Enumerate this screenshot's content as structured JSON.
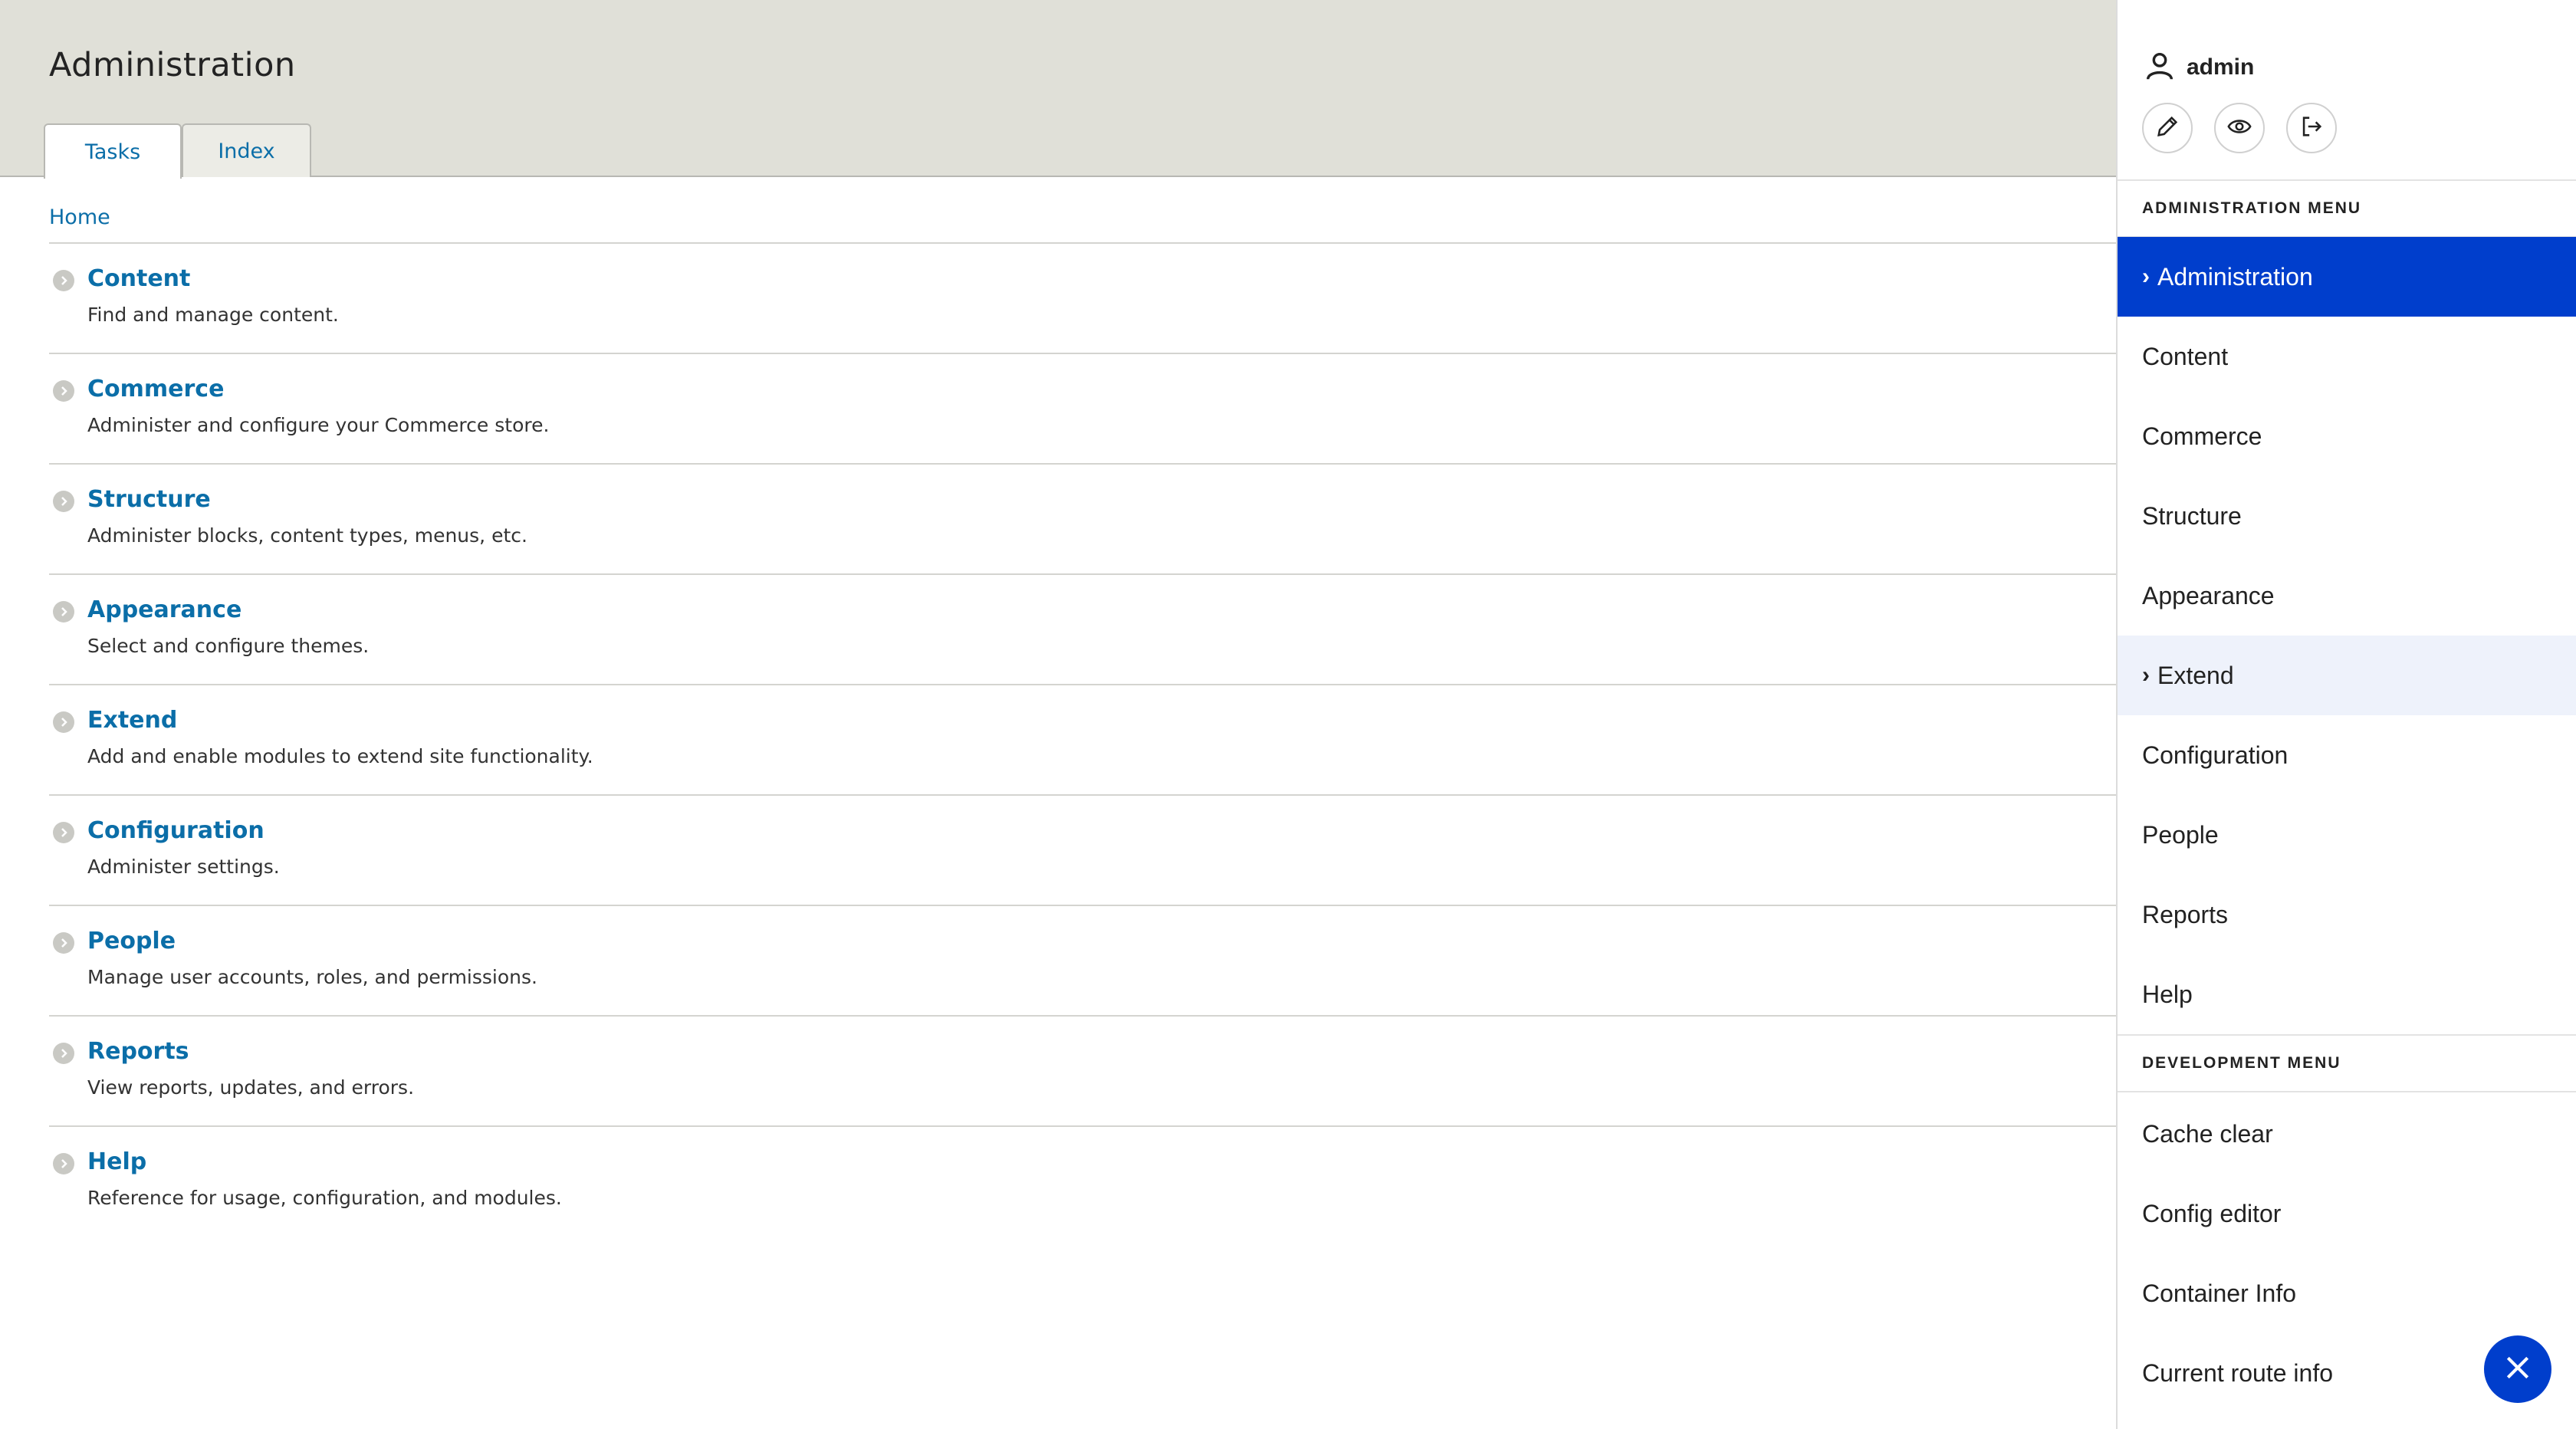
{
  "page": {
    "title": "Administration",
    "tabs": [
      {
        "label": "Tasks"
      },
      {
        "label": "Index"
      }
    ],
    "breadcrumb": "Home"
  },
  "tasks": [
    {
      "title": "Content",
      "description": "Find and manage content."
    },
    {
      "title": "Commerce",
      "description": "Administer and configure your Commerce store."
    },
    {
      "title": "Structure",
      "description": "Administer blocks, content types, menus, etc."
    },
    {
      "title": "Appearance",
      "description": "Select and configure themes."
    },
    {
      "title": "Extend",
      "description": "Add and enable modules to extend site functionality."
    },
    {
      "title": "Configuration",
      "description": "Administer settings."
    },
    {
      "title": "People",
      "description": "Manage user accounts, roles, and permissions."
    },
    {
      "title": "Reports",
      "description": "View reports, updates, and errors."
    },
    {
      "title": "Help",
      "description": "Reference for usage, configuration, and modules."
    }
  ],
  "sidebar": {
    "user": "admin",
    "tool_icons": [
      "pencil-icon",
      "eye-icon",
      "logout-icon"
    ],
    "admin_menu": {
      "heading": "ADMINISTRATION MENU",
      "items": [
        {
          "label": "Administration",
          "chevron": "›"
        },
        {
          "label": "Content"
        },
        {
          "label": "Commerce"
        },
        {
          "label": "Structure"
        },
        {
          "label": "Appearance"
        },
        {
          "label": "Extend",
          "chevron": "›"
        },
        {
          "label": "Configuration"
        },
        {
          "label": "People"
        },
        {
          "label": "Reports"
        },
        {
          "label": "Help"
        }
      ]
    },
    "dev_menu": {
      "heading": "DEVELOPMENT MENU",
      "items": [
        {
          "label": "Cache clear"
        },
        {
          "label": "Config editor"
        },
        {
          "label": "Container Info"
        },
        {
          "label": "Current route info"
        }
      ]
    }
  },
  "colors": {
    "link": "#0b6ea8",
    "accent": "#003ecc",
    "header_bg": "#e0e0d8"
  }
}
